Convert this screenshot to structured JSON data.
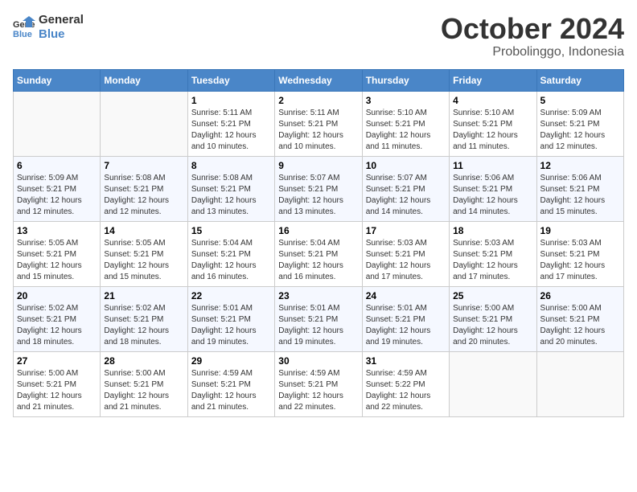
{
  "header": {
    "logo_line1": "General",
    "logo_line2": "Blue",
    "month": "October 2024",
    "location": "Probolinggo, Indonesia"
  },
  "weekdays": [
    "Sunday",
    "Monday",
    "Tuesday",
    "Wednesday",
    "Thursday",
    "Friday",
    "Saturday"
  ],
  "weeks": [
    [
      {
        "day": "",
        "info": ""
      },
      {
        "day": "",
        "info": ""
      },
      {
        "day": "1",
        "info": "Sunrise: 5:11 AM\nSunset: 5:21 PM\nDaylight: 12 hours and 10 minutes."
      },
      {
        "day": "2",
        "info": "Sunrise: 5:11 AM\nSunset: 5:21 PM\nDaylight: 12 hours and 10 minutes."
      },
      {
        "day": "3",
        "info": "Sunrise: 5:10 AM\nSunset: 5:21 PM\nDaylight: 12 hours and 11 minutes."
      },
      {
        "day": "4",
        "info": "Sunrise: 5:10 AM\nSunset: 5:21 PM\nDaylight: 12 hours and 11 minutes."
      },
      {
        "day": "5",
        "info": "Sunrise: 5:09 AM\nSunset: 5:21 PM\nDaylight: 12 hours and 12 minutes."
      }
    ],
    [
      {
        "day": "6",
        "info": "Sunrise: 5:09 AM\nSunset: 5:21 PM\nDaylight: 12 hours and 12 minutes."
      },
      {
        "day": "7",
        "info": "Sunrise: 5:08 AM\nSunset: 5:21 PM\nDaylight: 12 hours and 12 minutes."
      },
      {
        "day": "8",
        "info": "Sunrise: 5:08 AM\nSunset: 5:21 PM\nDaylight: 12 hours and 13 minutes."
      },
      {
        "day": "9",
        "info": "Sunrise: 5:07 AM\nSunset: 5:21 PM\nDaylight: 12 hours and 13 minutes."
      },
      {
        "day": "10",
        "info": "Sunrise: 5:07 AM\nSunset: 5:21 PM\nDaylight: 12 hours and 14 minutes."
      },
      {
        "day": "11",
        "info": "Sunrise: 5:06 AM\nSunset: 5:21 PM\nDaylight: 12 hours and 14 minutes."
      },
      {
        "day": "12",
        "info": "Sunrise: 5:06 AM\nSunset: 5:21 PM\nDaylight: 12 hours and 15 minutes."
      }
    ],
    [
      {
        "day": "13",
        "info": "Sunrise: 5:05 AM\nSunset: 5:21 PM\nDaylight: 12 hours and 15 minutes."
      },
      {
        "day": "14",
        "info": "Sunrise: 5:05 AM\nSunset: 5:21 PM\nDaylight: 12 hours and 15 minutes."
      },
      {
        "day": "15",
        "info": "Sunrise: 5:04 AM\nSunset: 5:21 PM\nDaylight: 12 hours and 16 minutes."
      },
      {
        "day": "16",
        "info": "Sunrise: 5:04 AM\nSunset: 5:21 PM\nDaylight: 12 hours and 16 minutes."
      },
      {
        "day": "17",
        "info": "Sunrise: 5:03 AM\nSunset: 5:21 PM\nDaylight: 12 hours and 17 minutes."
      },
      {
        "day": "18",
        "info": "Sunrise: 5:03 AM\nSunset: 5:21 PM\nDaylight: 12 hours and 17 minutes."
      },
      {
        "day": "19",
        "info": "Sunrise: 5:03 AM\nSunset: 5:21 PM\nDaylight: 12 hours and 17 minutes."
      }
    ],
    [
      {
        "day": "20",
        "info": "Sunrise: 5:02 AM\nSunset: 5:21 PM\nDaylight: 12 hours and 18 minutes."
      },
      {
        "day": "21",
        "info": "Sunrise: 5:02 AM\nSunset: 5:21 PM\nDaylight: 12 hours and 18 minutes."
      },
      {
        "day": "22",
        "info": "Sunrise: 5:01 AM\nSunset: 5:21 PM\nDaylight: 12 hours and 19 minutes."
      },
      {
        "day": "23",
        "info": "Sunrise: 5:01 AM\nSunset: 5:21 PM\nDaylight: 12 hours and 19 minutes."
      },
      {
        "day": "24",
        "info": "Sunrise: 5:01 AM\nSunset: 5:21 PM\nDaylight: 12 hours and 19 minutes."
      },
      {
        "day": "25",
        "info": "Sunrise: 5:00 AM\nSunset: 5:21 PM\nDaylight: 12 hours and 20 minutes."
      },
      {
        "day": "26",
        "info": "Sunrise: 5:00 AM\nSunset: 5:21 PM\nDaylight: 12 hours and 20 minutes."
      }
    ],
    [
      {
        "day": "27",
        "info": "Sunrise: 5:00 AM\nSunset: 5:21 PM\nDaylight: 12 hours and 21 minutes."
      },
      {
        "day": "28",
        "info": "Sunrise: 5:00 AM\nSunset: 5:21 PM\nDaylight: 12 hours and 21 minutes."
      },
      {
        "day": "29",
        "info": "Sunrise: 4:59 AM\nSunset: 5:21 PM\nDaylight: 12 hours and 21 minutes."
      },
      {
        "day": "30",
        "info": "Sunrise: 4:59 AM\nSunset: 5:21 PM\nDaylight: 12 hours and 22 minutes."
      },
      {
        "day": "31",
        "info": "Sunrise: 4:59 AM\nSunset: 5:22 PM\nDaylight: 12 hours and 22 minutes."
      },
      {
        "day": "",
        "info": ""
      },
      {
        "day": "",
        "info": ""
      }
    ]
  ]
}
